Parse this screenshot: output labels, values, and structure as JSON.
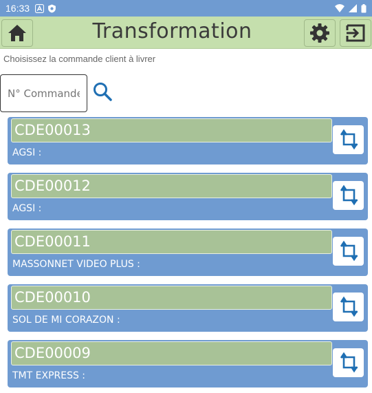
{
  "status_bar": {
    "time": "16:33",
    "icons": [
      "notification-a-icon",
      "shield-icon",
      "wifi-icon",
      "signal-icon",
      "battery-icon"
    ]
  },
  "app_bar": {
    "title": "Transformation",
    "home_icon": "home-icon",
    "settings_icon": "gear-icon",
    "exit_icon": "exit-icon"
  },
  "instruction": "Choisissez la commande client à livrer",
  "search": {
    "placeholder": "N° Commande",
    "value": "",
    "icon": "search-icon"
  },
  "orders": [
    {
      "code": "CDE00013",
      "client": "AGSI  :"
    },
    {
      "code": "CDE00012",
      "client": "AGSI  :"
    },
    {
      "code": "CDE00011",
      "client": "MASSONNET VIDEO PLUS  :"
    },
    {
      "code": "CDE00010",
      "client": "SOL DE MI CORAZON  :"
    },
    {
      "code": "CDE00009",
      "client": "TMT EXPRESS  :"
    }
  ],
  "colors": {
    "status_bar": "#6f9bd1",
    "app_bar": "#c5dfad",
    "card": "#6f9bd1",
    "code_field": "#a8c297",
    "accent_icon": "#1f6fb3"
  }
}
